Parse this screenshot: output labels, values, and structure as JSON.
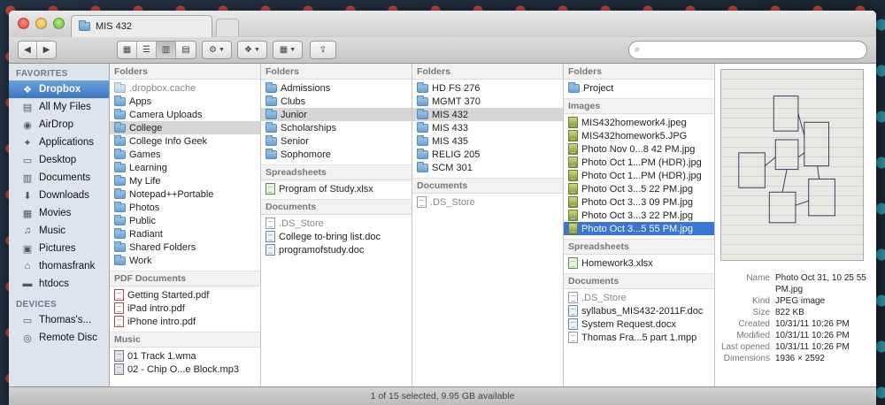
{
  "window": {
    "tab_title": "MIS 432"
  },
  "search": {
    "placeholder": ""
  },
  "sidebar": {
    "favorites_heading": "FAVORITES",
    "favorites": [
      {
        "label": "Dropbox",
        "icon": "dropbox-icon",
        "active": true
      },
      {
        "label": "All My Files",
        "icon": "all-files-icon"
      },
      {
        "label": "AirDrop",
        "icon": "airdrop-icon"
      },
      {
        "label": "Applications",
        "icon": "applications-icon"
      },
      {
        "label": "Desktop",
        "icon": "desktop-icon"
      },
      {
        "label": "Documents",
        "icon": "documents-icon"
      },
      {
        "label": "Downloads",
        "icon": "downloads-icon"
      },
      {
        "label": "Movies",
        "icon": "movies-icon"
      },
      {
        "label": "Music",
        "icon": "music-icon"
      },
      {
        "label": "Pictures",
        "icon": "pictures-icon"
      },
      {
        "label": "thomasfrank",
        "icon": "home-icon"
      },
      {
        "label": "htdocs",
        "icon": "folder-icon"
      }
    ],
    "devices_heading": "DEVICES",
    "devices": [
      {
        "label": "Thomas's...",
        "icon": "laptop-icon"
      },
      {
        "label": "Remote Disc",
        "icon": "disc-icon"
      }
    ]
  },
  "columns": {
    "col1": {
      "folders_head": "Folders",
      "folders": [
        ".dropbox.cache",
        "Apps",
        "Camera Uploads",
        "College",
        "College Info Geek",
        "Games",
        "Learning",
        "My Life",
        "Notepad++Portable",
        "Photos",
        "Public",
        "Radiant",
        "Shared Folders",
        "Work"
      ],
      "pdf_head": "PDF Documents",
      "pdfs": [
        "Getting Started.pdf",
        "iPad intro.pdf",
        "iPhone intro.pdf"
      ],
      "music_head": "Music",
      "music": [
        "01 Track 1.wma",
        "02 - Chip O...e Block.mp3"
      ]
    },
    "col2": {
      "folders_head": "Folders",
      "folders": [
        "Admissions",
        "Clubs",
        "Junior",
        "Scholarships",
        "Senior",
        "Sophomore"
      ],
      "sheets_head": "Spreadsheets",
      "sheets": [
        "Program of Study.xlsx"
      ],
      "docs_head": "Documents",
      "docs": [
        ".DS_Store",
        "College to-bring list.doc",
        "programofstudy.doc"
      ]
    },
    "col3": {
      "folders_head": "Folders",
      "folders": [
        "HD FS 276",
        "MGMT 370",
        "MIS 432",
        "MIS 433",
        "MIS 435",
        "RELIG 205",
        "SCM 301"
      ],
      "docs_head": "Documents",
      "docs": [
        ".DS_Store"
      ]
    },
    "col4": {
      "folders_head": "Folders",
      "folders": [
        "Project"
      ],
      "images_head": "Images",
      "images": [
        "MIS432homework4.jpeg",
        "MIS432homework5.JPG",
        "Photo Nov 0...8 42 PM.jpg",
        "Photo Oct 1...PM (HDR).jpg",
        "Photo Oct 1...PM (HDR).jpg",
        "Photo Oct 3...5 22 PM.jpg",
        "Photo Oct 3...3 09 PM.jpg",
        "Photo Oct 3...3 22 PM.jpg",
        "Photo Oct 3...5 55 PM.jpg"
      ],
      "sheets_head": "Spreadsheets",
      "sheets": [
        "Homework3.xlsx"
      ],
      "docs_head": "Documents",
      "docs": [
        ".DS_Store",
        "syllabus_MIS432-2011F.doc",
        "System Request.docx",
        "Thomas Fra...5 part 1.mpp"
      ]
    }
  },
  "preview": {
    "info": [
      {
        "key": "Name",
        "value": "Photo Oct 31, 10 25 55 PM.jpg"
      },
      {
        "key": "Kind",
        "value": "JPEG image"
      },
      {
        "key": "Size",
        "value": "822 KB"
      },
      {
        "key": "Created",
        "value": "10/31/11 10:26 PM"
      },
      {
        "key": "Modified",
        "value": "10/31/11 10:26 PM"
      },
      {
        "key": "Last opened",
        "value": "10/31/11 10:26 PM"
      },
      {
        "key": "Dimensions",
        "value": "1936 × 2592"
      }
    ]
  },
  "status": {
    "text": "1 of 15 selected, 9.95 GB available"
  }
}
